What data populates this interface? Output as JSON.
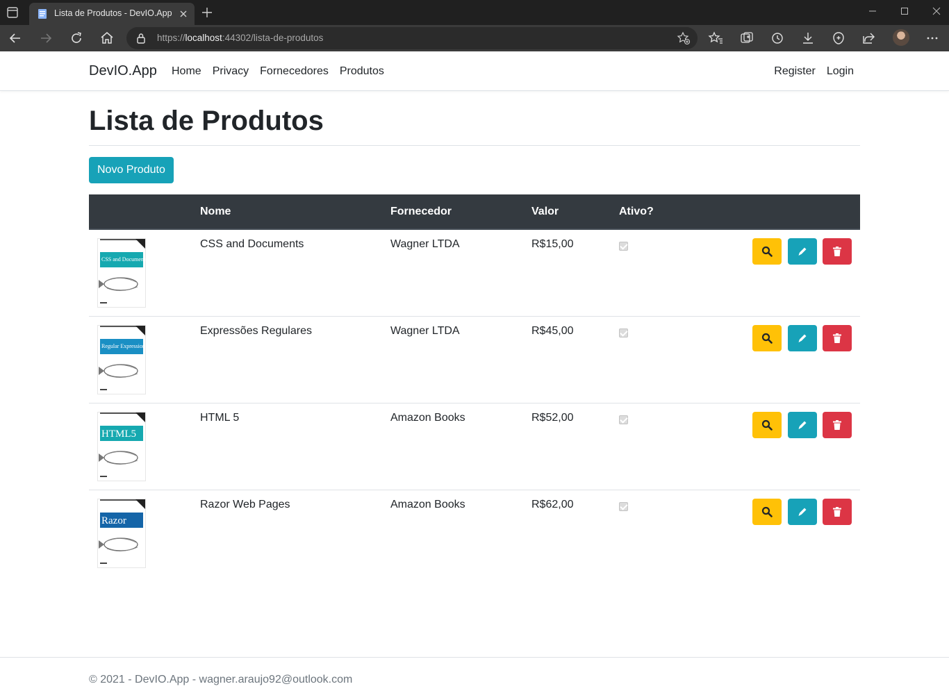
{
  "browser": {
    "tab_title": "Lista de Produtos - DevIO.App",
    "url_scheme": "https://",
    "url_host": "localhost",
    "url_rest": ":44302/lista-de-produtos"
  },
  "navbar": {
    "brand": "DevIO.App",
    "links": [
      "Home",
      "Privacy",
      "Fornecedores",
      "Produtos"
    ],
    "register": "Register",
    "login": "Login"
  },
  "page": {
    "title": "Lista de Produtos",
    "new_button": "Novo Produto"
  },
  "table": {
    "headers": [
      "",
      "Nome",
      "Fornecedor",
      "Valor",
      "Ativo?",
      ""
    ],
    "rows": [
      {
        "cover_title": "CSS and Documents",
        "cover_style": "teal",
        "nome": "CSS and Documents",
        "fornecedor": "Wagner LTDA",
        "valor": "R$15,00",
        "ativo": true
      },
      {
        "cover_title": "Regular Expression",
        "cover_style": "blue",
        "nome": "Expressões Regulares",
        "fornecedor": "Wagner LTDA",
        "valor": "R$45,00",
        "ativo": true
      },
      {
        "cover_title": "HTML5",
        "cover_style": "teal",
        "nome": "HTML 5",
        "fornecedor": "Amazon Books",
        "valor": "R$52,00",
        "ativo": true
      },
      {
        "cover_title": "Razor",
        "cover_style": "darkblue",
        "nome": "Razor Web Pages",
        "fornecedor": "Amazon Books",
        "valor": "R$62,00",
        "ativo": true
      }
    ]
  },
  "footer": {
    "text": "© 2021 - DevIO.App - wagner.araujo92@outlook.com"
  },
  "colors": {
    "primary_info": "#17a2b8",
    "warning": "#ffc107",
    "danger": "#dc3545",
    "table_head": "#343a40"
  }
}
